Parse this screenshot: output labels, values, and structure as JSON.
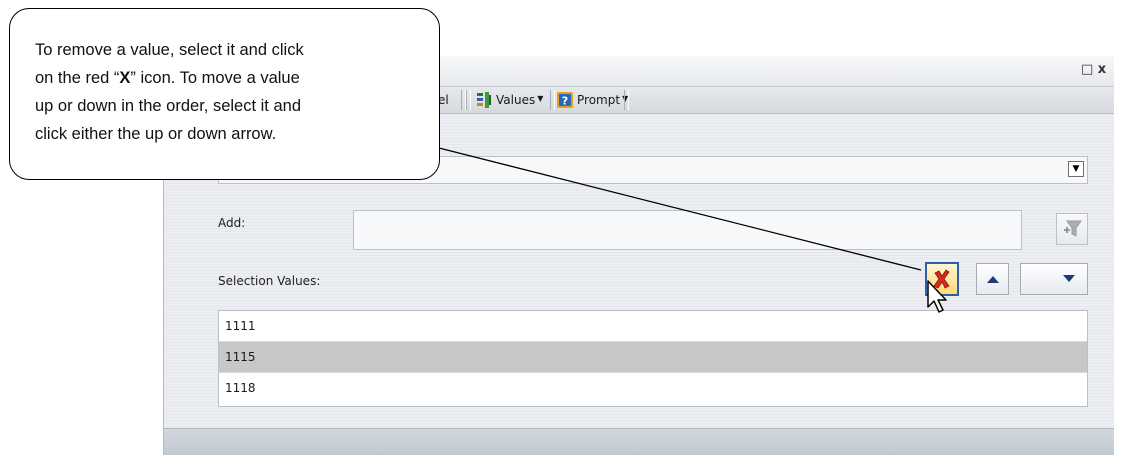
{
  "window": {
    "maximize_glyph": "□",
    "close_glyph": "x"
  },
  "toolbar": {
    "partial_label": "el",
    "values_label": "Values",
    "prompt_label": "Prompt"
  },
  "form": {
    "top_select_value": "",
    "add_label": "Add:",
    "add_value": "",
    "selection_values_label": "Selection Values:",
    "selection_values": [
      {
        "value": "1111",
        "selected": false
      },
      {
        "value": "1115",
        "selected": true
      },
      {
        "value": "1118",
        "selected": false
      }
    ]
  },
  "icons": {
    "delete": "red-x-icon",
    "move_up": "up-arrow-icon",
    "move_down": "down-arrow-icon",
    "filter_add": "funnel-plus-icon",
    "values": "values-icon",
    "prompt": "prompt-icon"
  },
  "callout": {
    "line1": "To remove a value, select it and click",
    "line2_prefix": "on the red “",
    "line2_bold": "X",
    "line2_suffix": "” icon.  To move a value",
    "line3": "up or down in the order, select it and",
    "line4": "click either the up or down arrow."
  },
  "colors": {
    "accent_border": "#2f5fa8",
    "delete_red": "#d42a1c",
    "arrow_blue": "#1f3b77",
    "selected_row": "#c7c7c7"
  }
}
